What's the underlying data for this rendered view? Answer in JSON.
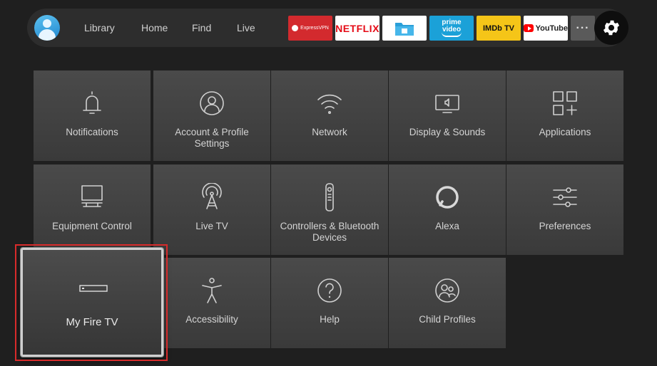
{
  "topbar": {
    "nav": [
      "Library",
      "Home",
      "Find",
      "Live"
    ],
    "apps": {
      "expressvpn": "ExpressVPN",
      "netflix": "NETFLIX",
      "prime_line1": "prime",
      "prime_line2": "video",
      "imdb": "IMDb TV",
      "youtube": "YouTube",
      "more": "···"
    }
  },
  "tiles": [
    {
      "label": "Notifications",
      "icon": "bell-icon"
    },
    {
      "label": "Account & Profile Settings",
      "icon": "profile-icon"
    },
    {
      "label": "Network",
      "icon": "wifi-icon"
    },
    {
      "label": "Display & Sounds",
      "icon": "display-sound-icon"
    },
    {
      "label": "Applications",
      "icon": "applications-grid-icon"
    },
    {
      "label": "Equipment Control",
      "icon": "tv-equipment-icon"
    },
    {
      "label": "Live TV",
      "icon": "antenna-icon"
    },
    {
      "label": "Controllers & Bluetooth Devices",
      "icon": "remote-icon"
    },
    {
      "label": "Alexa",
      "icon": "alexa-icon"
    },
    {
      "label": "Preferences",
      "icon": "sliders-icon"
    },
    {
      "label": "My Fire TV",
      "icon": "fire-tv-device-icon",
      "selected": true
    },
    {
      "label": "Accessibility",
      "icon": "accessibility-icon"
    },
    {
      "label": "Help",
      "icon": "help-icon"
    },
    {
      "label": "Child Profiles",
      "icon": "child-profiles-icon"
    }
  ],
  "colors": {
    "background": "#1f1f1f",
    "tile": "#444444",
    "highlight": "#d82b2b",
    "netflix_red": "#e50914",
    "prime_blue": "#1ba1d8",
    "imdb_yellow": "#f5c518"
  }
}
